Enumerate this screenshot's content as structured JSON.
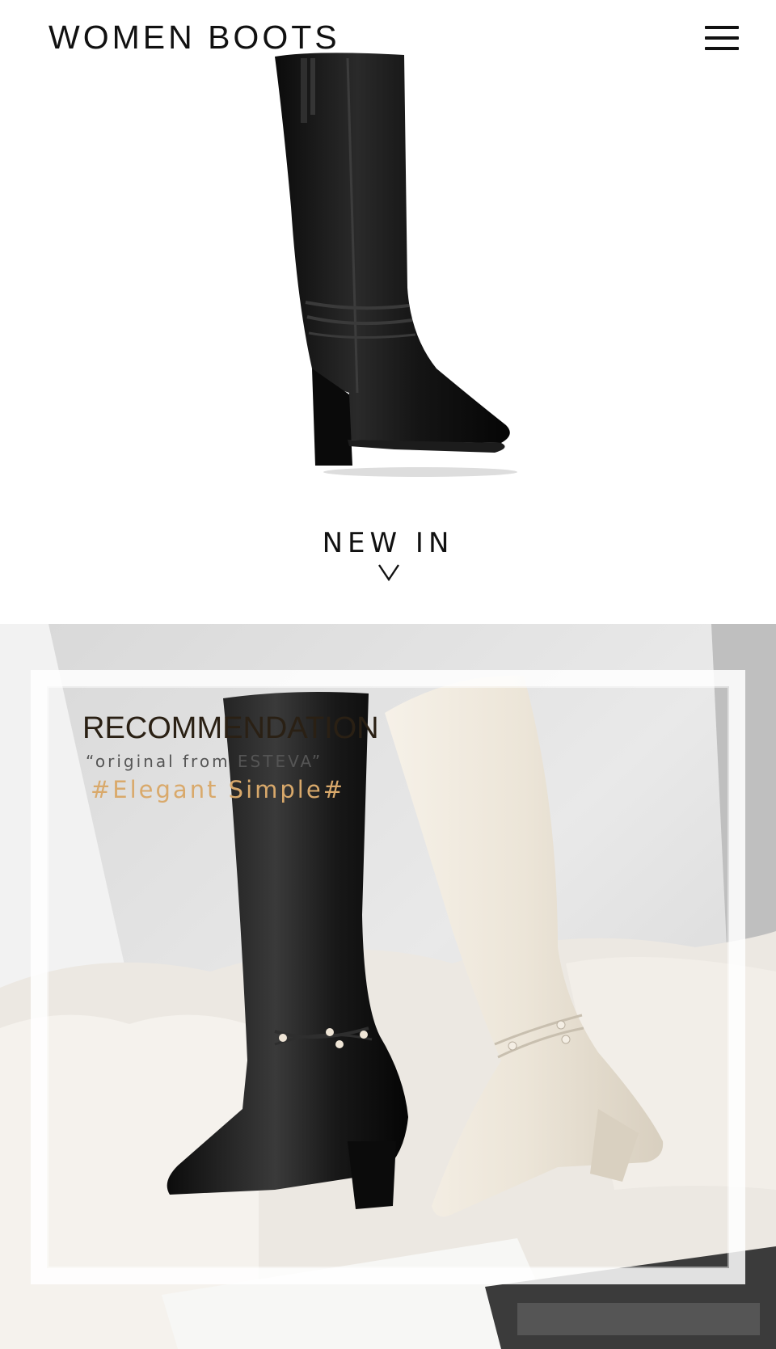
{
  "header": {
    "title": "WOMEN BOOTS",
    "menu_icon": "hamburger-menu-icon"
  },
  "hero": {
    "image": "black knee-high boot with block heel"
  },
  "new_in": {
    "label": "NEW IN",
    "icon": "chevron-down-icon"
  },
  "recommendation": {
    "heading": "RECOMMENDATION",
    "quote": "“original from ESTEVA”",
    "tagline": "#Elegant Simple#",
    "colors": {
      "heading": "#2a2014",
      "quote": "#555555",
      "tagline": "#d9a96b"
    }
  }
}
